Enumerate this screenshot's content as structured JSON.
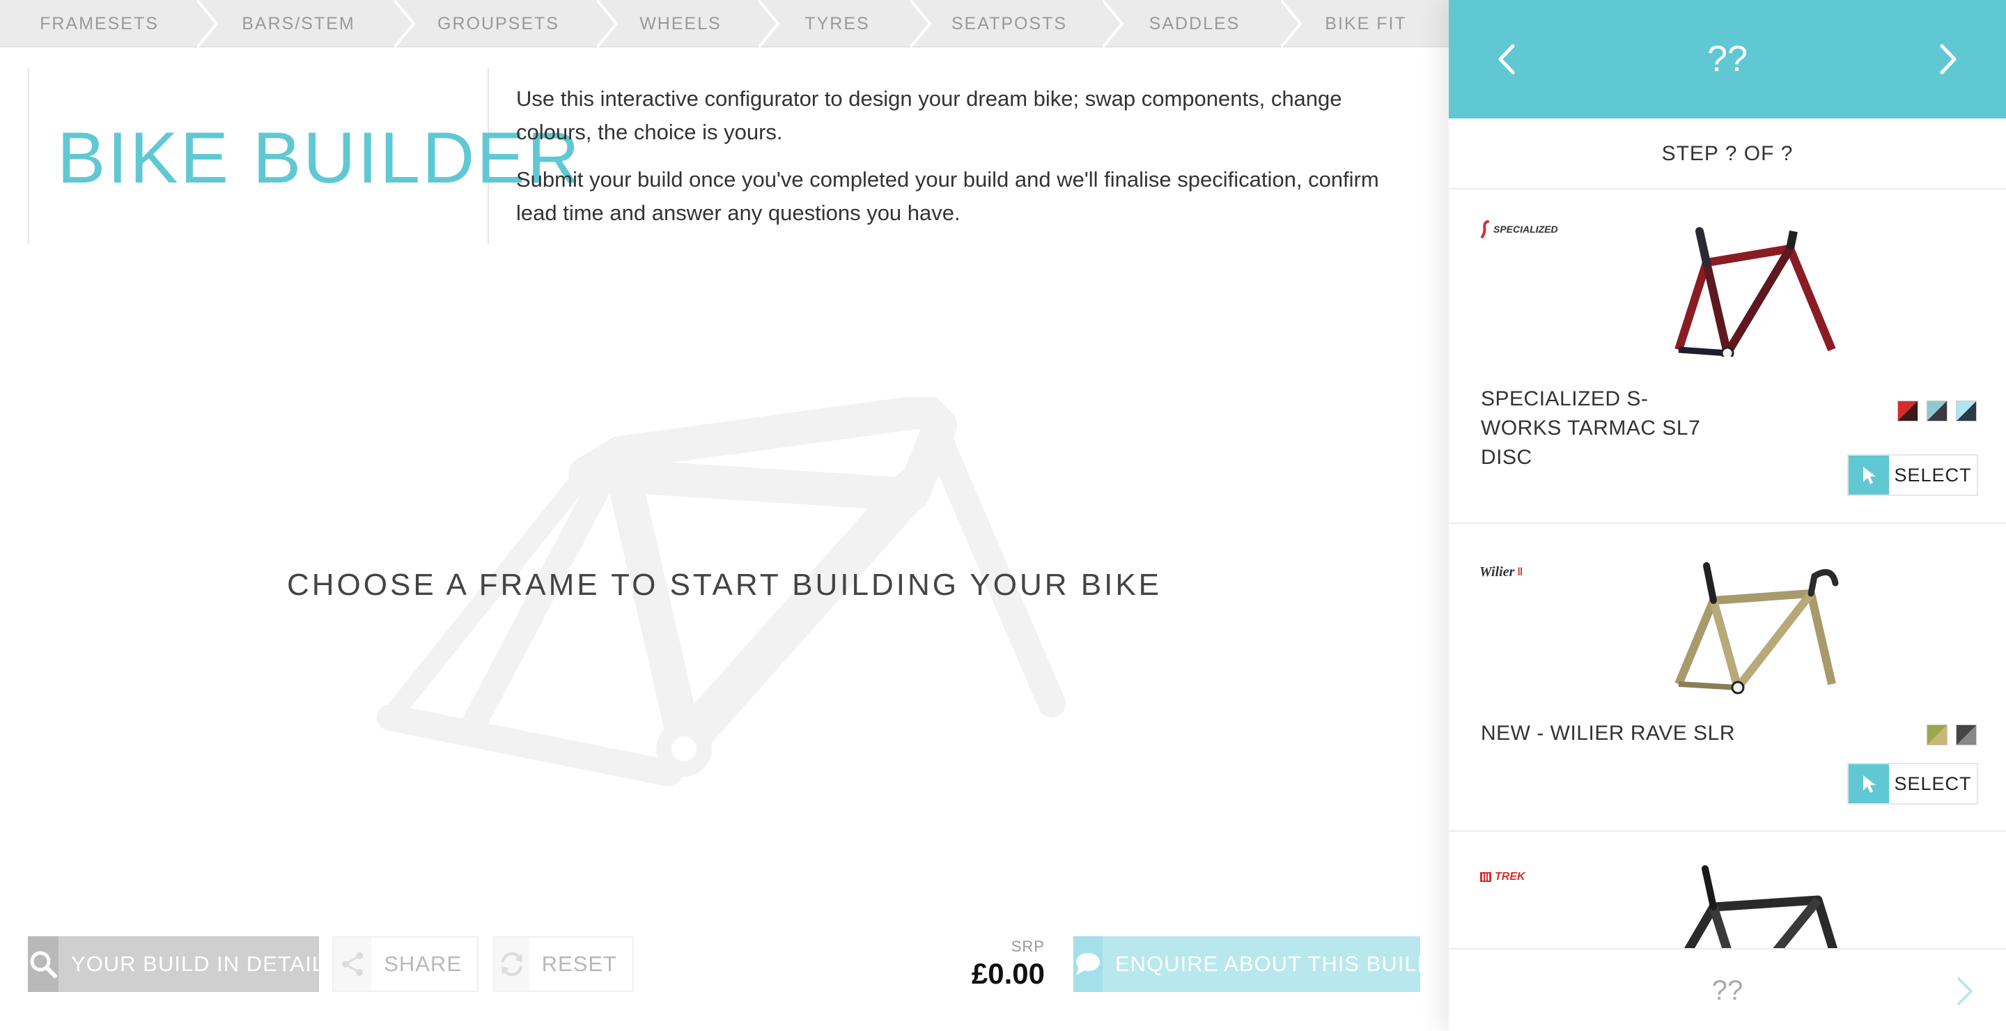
{
  "nav": {
    "steps": [
      "FRAMESETS",
      "BARS/STEM",
      "GROUPSETS",
      "WHEELS",
      "TYRES",
      "SEATPOSTS",
      "SADDLES",
      "BIKE FIT"
    ]
  },
  "intro": {
    "title": "BIKE BUILDER",
    "paragraph1": "Use this interactive configurator to design your dream bike; swap components, change colours, the choice is yours.",
    "paragraph2": "Submit your build once you've completed your build and we'll finalise specification, confirm lead time and answer any questions you have."
  },
  "canvas": {
    "prompt": "CHOOSE A FRAME TO START BUILDING YOUR BIKE"
  },
  "bottom_bar": {
    "detail_label": "YOUR BUILD IN DETAIL",
    "share_label": "SHARE",
    "reset_label": "RESET",
    "srp_label": "SRP",
    "price": "£0.00",
    "enquire_label": "ENQUIRE ABOUT THIS BUILD"
  },
  "sidebar": {
    "header_title": "??",
    "step_text": "STEP ? OF ?",
    "footer_title": "??",
    "products": [
      {
        "brand": "SPECIALIZED",
        "name": "SPECIALIZED S-WORKS TARMAC SL7 DISC",
        "swatches": [
          "#d92b2b",
          "#8fc8d0",
          "#aee6ee"
        ],
        "select_label": "SELECT"
      },
      {
        "brand": "Wilier",
        "name": "NEW - WILIER RAVE SLR",
        "swatches": [
          "#9aa84a",
          "#444444"
        ],
        "select_label": "SELECT"
      },
      {
        "brand": "TREK",
        "name": "",
        "swatches": [],
        "select_label": ""
      }
    ]
  },
  "colors": {
    "accent": "#5fc8d3",
    "accent_light": "#b8e8ee"
  }
}
